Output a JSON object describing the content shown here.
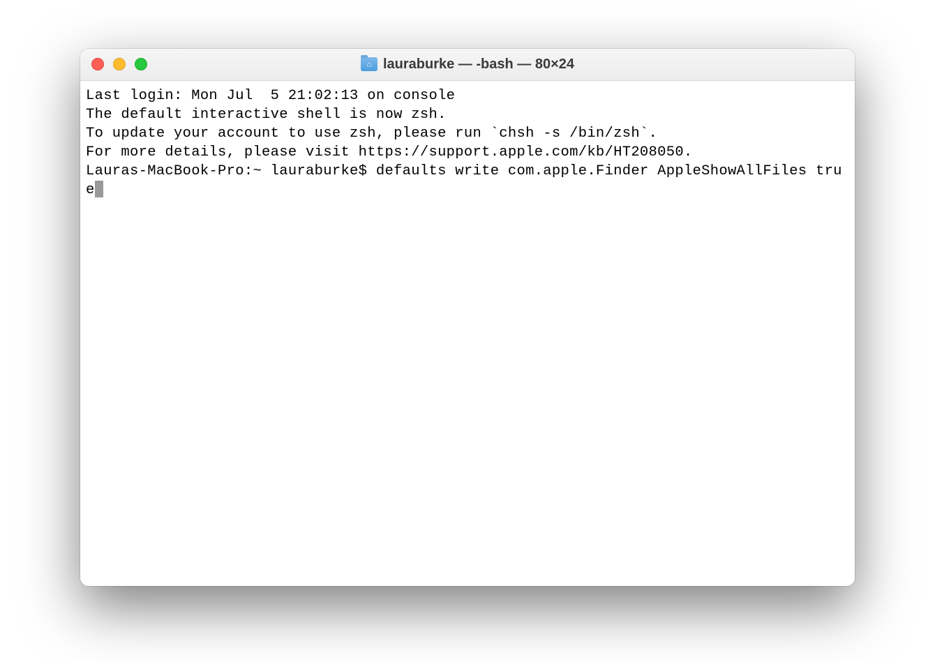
{
  "window": {
    "title": "lauraburke — -bash — 80×24"
  },
  "terminal": {
    "last_login": "Last login: Mon Jul  5 21:02:13 on console",
    "blank_line": "",
    "zsh_notice_1": "The default interactive shell is now zsh.",
    "zsh_notice_2": "To update your account to use zsh, please run `chsh -s /bin/zsh`.",
    "zsh_notice_3": "For more details, please visit https://support.apple.com/kb/HT208050.",
    "prompt_line": "Lauras-MacBook-Pro:~ lauraburke$ defaults write com.apple.Finder AppleShowAllFiles true"
  }
}
